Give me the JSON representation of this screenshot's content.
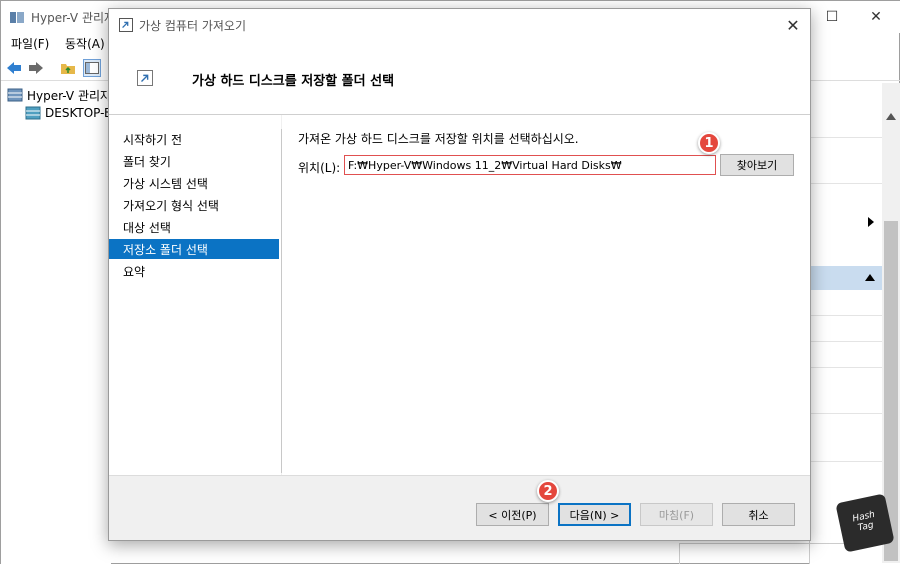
{
  "background_window": {
    "title": "Hyper-V 관리자",
    "menu": [
      "파일(F)",
      "동작(A)"
    ],
    "tree": {
      "root": "Hyper-V 관리자",
      "host": "DESKTOP-B"
    },
    "controls": {
      "minimize": "—",
      "maximize": "☐",
      "close": "✕"
    }
  },
  "dialog": {
    "title": "가상 컴퓨터 가져오기",
    "close_glyph": "✕",
    "header_title": "가상 하드 디스크를 저장할 폴더 선택",
    "nav": [
      {
        "label": "시작하기 전",
        "active": false
      },
      {
        "label": "폴더 찾기",
        "active": false
      },
      {
        "label": "가상 시스템 선택",
        "active": false
      },
      {
        "label": "가져오기 형식 선택",
        "active": false
      },
      {
        "label": "대상 선택",
        "active": false
      },
      {
        "label": "저장소 폴더 선택",
        "active": true
      },
      {
        "label": "요약",
        "active": false
      }
    ],
    "instruction": "가져온 가상 하드 디스크를 저장할 위치를 선택하십시오.",
    "location_label": "위치(L):",
    "location_value": "F:₩Hyper-V₩Windows 11_2₩Virtual Hard Disks₩",
    "browse_label": "찾아보기",
    "buttons": {
      "prev": "< 이전(P)",
      "next": "다음(N) >",
      "finish": "마침(F)",
      "cancel": "취소"
    }
  },
  "annotations": {
    "badge1": "1",
    "badge2": "2"
  },
  "watermark": {
    "line1": "Hash",
    "line2": "Tag"
  },
  "colors": {
    "accent": "#0b73c4",
    "badge": "#e4473d",
    "input_border": "#e05050"
  }
}
